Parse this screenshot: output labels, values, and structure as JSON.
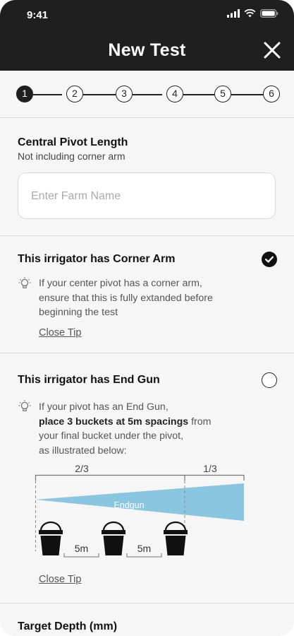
{
  "status_bar": {
    "time": "9:41"
  },
  "header": {
    "title": "New Test"
  },
  "stepper": {
    "steps": [
      "1",
      "2",
      "3",
      "4",
      "5",
      "6"
    ],
    "active": 1
  },
  "pivot_length": {
    "title": "Central Pivot Length",
    "subtitle": "Not including corner arm",
    "placeholder": "Enter Farm Name"
  },
  "corner_arm": {
    "title": "This irrigator has Corner Arm",
    "checked": true,
    "tip_line1": "If your center pivot has a corner arm,",
    "tip_line2": "ensure that this is fully extanded before",
    "tip_line3": "beginning the test",
    "close_tip": "Close Tip"
  },
  "end_gun": {
    "title": "This irrigator has End Gun",
    "checked": false,
    "tip_line1": "If your pivot has an End Gun,",
    "tip_line2_bold": "place 3 buckets at 5m spacings",
    "tip_line2_rest": " from",
    "tip_line3": "your final bucket under the pivot,",
    "tip_line4": "as illustrated below:",
    "close_tip": "Close Tip",
    "diagram": {
      "left_fraction": "2/3",
      "right_fraction": "1/3",
      "endgun_label": "Endgun",
      "spacing1": "5m",
      "spacing2": "5m",
      "spray_color": "#8ac6df"
    }
  },
  "target_depth": {
    "title": "Target Depth (mm)"
  },
  "colors": {
    "header_bg": "#1f1f1f",
    "page_bg": "#f6f6f6",
    "accent": "#8ac6df"
  }
}
